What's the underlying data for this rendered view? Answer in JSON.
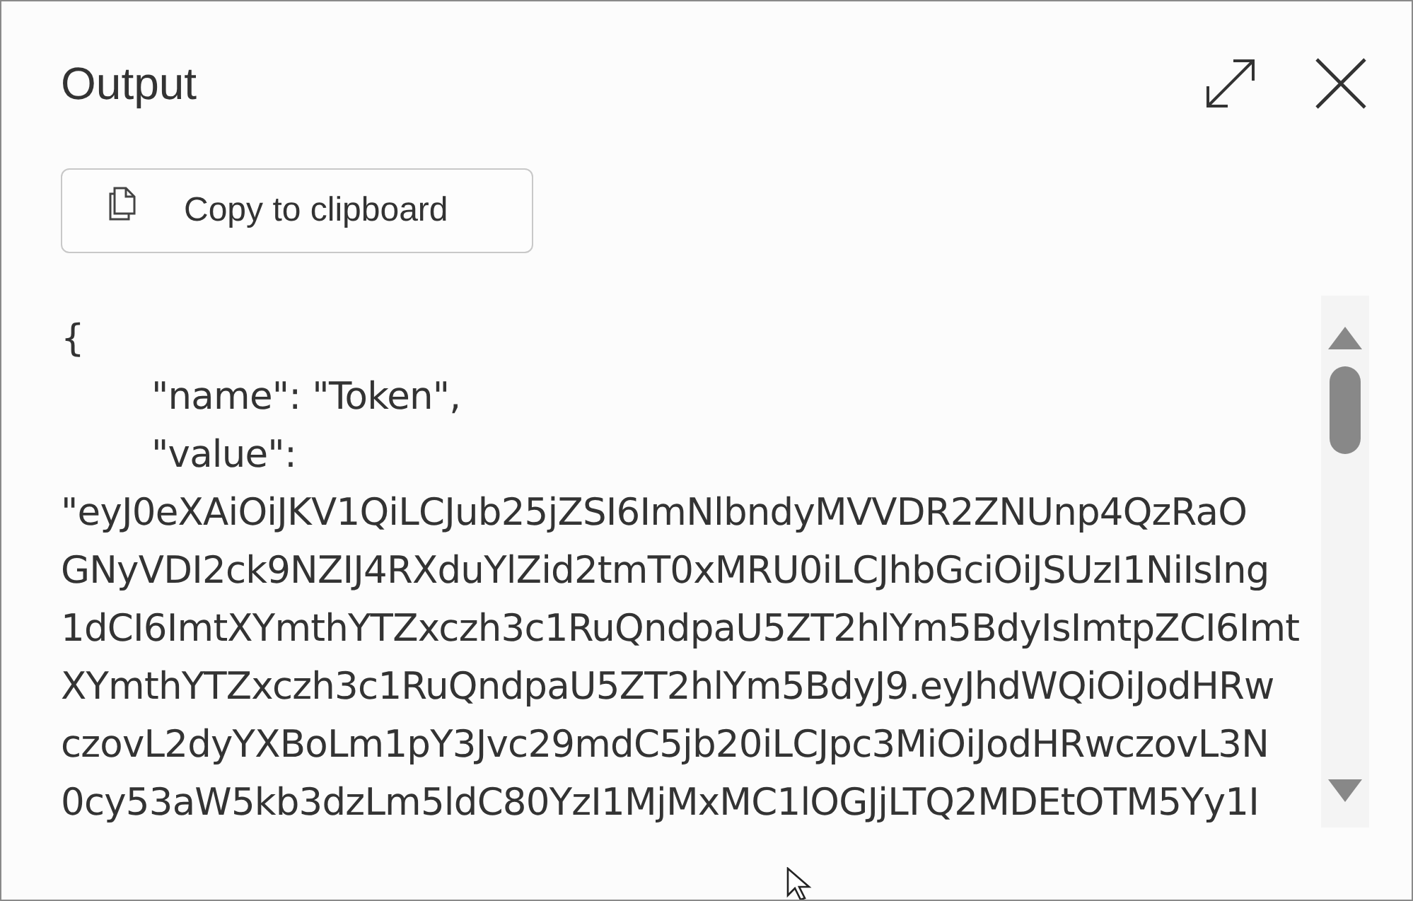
{
  "panel": {
    "title": "Output"
  },
  "copy_button": {
    "label": "Copy to clipboard"
  },
  "output_lines": [
    {
      "text": "{",
      "indented": false
    },
    {
      "text": "\"name\": \"Token\",",
      "indented": true
    },
    {
      "text": "\"value\":",
      "indented": true
    },
    {
      "text": "\"eyJ0eXAiOiJKV1QiLCJub25jZSI6ImNlbndyMVVDR2ZNUnp4QzRaO",
      "indented": false
    },
    {
      "text": "GNyVDI2ck9NZIJ4RXduYlZid2tmT0xMRU0iLCJhbGciOiJSUzI1NiIsIng",
      "indented": false
    },
    {
      "text": "1dCI6ImtXYmthYTZxczh3c1RuQndpaU5ZT2hlYm5BdyIsImtpZCI6Imt",
      "indented": false
    },
    {
      "text": "XYmthYTZxczh3c1RuQndpaU5ZT2hlYm5BdyJ9.eyJhdWQiOiJodHRw",
      "indented": false
    },
    {
      "text": "czovL2dyYXBoLm1pY3Jvc29mdC5jb20iLCJpc3MiOiJodHRwczovL3N",
      "indented": false
    },
    {
      "text": "0cy53aW5kb3dzLm5ldC80YzI1MjMxMC1lOGJjLTQ2MDEtOTM5Yy1I",
      "indented": false
    }
  ]
}
